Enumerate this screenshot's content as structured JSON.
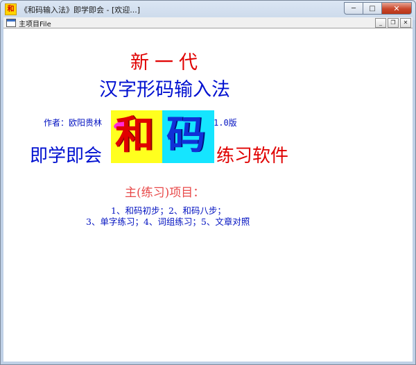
{
  "window": {
    "app_icon_glyph": "和",
    "title": "《和码输入法》即学即会 - [欢迎...]",
    "minimize_glyph": "─",
    "maximize_glyph": "□",
    "close_glyph": "✕"
  },
  "mdi": {
    "title": "主项目File",
    "minimize_glyph": "_",
    "restore_glyph": "❐",
    "close_glyph": "✕"
  },
  "content": {
    "headline1": "新一代",
    "headline2": "汉字形码输入法",
    "author": "作者：欧阳贵林",
    "version": "1.0版",
    "logo_char1": "和",
    "logo_char2": "码",
    "left_slogan": "即学即会",
    "right_slogan": "练习软件",
    "project_heading": "主(练习)项目：",
    "items_line1": "1、和码初步；2、和码八步；",
    "items_line2": "3、单字练习；4、词组练习；5、文章对照"
  },
  "colors": {
    "red": "#e00000",
    "blue": "#0010d0",
    "logo_yellow": "#ffff1e",
    "logo_cyan": "#15e5ff",
    "heading_pink": "#e84848"
  }
}
